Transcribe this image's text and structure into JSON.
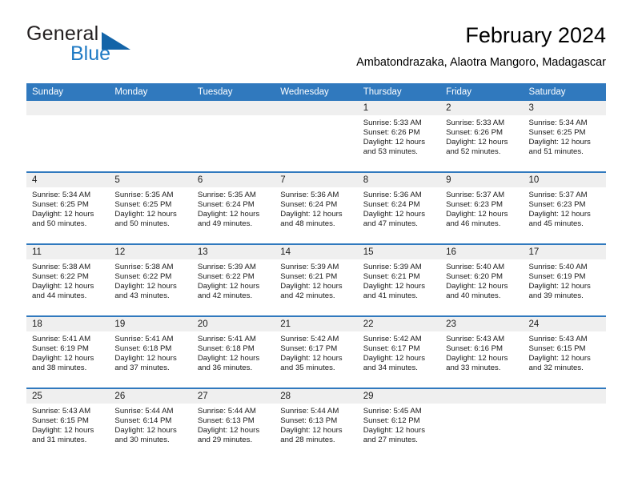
{
  "brand": {
    "name_part1": "General",
    "name_part2": "Blue",
    "logo_icon": "triangle-logo-icon",
    "accent_color": "#1f7ac4"
  },
  "header": {
    "title": "February 2024",
    "subtitle": "Ambatondrazaka, Alaotra Mangoro, Madagascar"
  },
  "theme": {
    "header_blue": "#3079be",
    "date_band_gray": "#efefef",
    "text_color": "#1a1a1a"
  },
  "calendar": {
    "weekdays": [
      "Sunday",
      "Monday",
      "Tuesday",
      "Wednesday",
      "Thursday",
      "Friday",
      "Saturday"
    ],
    "weeks": [
      [
        {
          "day": "",
          "sunrise": "",
          "sunset": "",
          "daylight_line1": "",
          "daylight_line2": ""
        },
        {
          "day": "",
          "sunrise": "",
          "sunset": "",
          "daylight_line1": "",
          "daylight_line2": ""
        },
        {
          "day": "",
          "sunrise": "",
          "sunset": "",
          "daylight_line1": "",
          "daylight_line2": ""
        },
        {
          "day": "",
          "sunrise": "",
          "sunset": "",
          "daylight_line1": "",
          "daylight_line2": ""
        },
        {
          "day": "1",
          "sunrise": "Sunrise: 5:33 AM",
          "sunset": "Sunset: 6:26 PM",
          "daylight_line1": "Daylight: 12 hours",
          "daylight_line2": "and 53 minutes."
        },
        {
          "day": "2",
          "sunrise": "Sunrise: 5:33 AM",
          "sunset": "Sunset: 6:26 PM",
          "daylight_line1": "Daylight: 12 hours",
          "daylight_line2": "and 52 minutes."
        },
        {
          "day": "3",
          "sunrise": "Sunrise: 5:34 AM",
          "sunset": "Sunset: 6:25 PM",
          "daylight_line1": "Daylight: 12 hours",
          "daylight_line2": "and 51 minutes."
        }
      ],
      [
        {
          "day": "4",
          "sunrise": "Sunrise: 5:34 AM",
          "sunset": "Sunset: 6:25 PM",
          "daylight_line1": "Daylight: 12 hours",
          "daylight_line2": "and 50 minutes."
        },
        {
          "day": "5",
          "sunrise": "Sunrise: 5:35 AM",
          "sunset": "Sunset: 6:25 PM",
          "daylight_line1": "Daylight: 12 hours",
          "daylight_line2": "and 50 minutes."
        },
        {
          "day": "6",
          "sunrise": "Sunrise: 5:35 AM",
          "sunset": "Sunset: 6:24 PM",
          "daylight_line1": "Daylight: 12 hours",
          "daylight_line2": "and 49 minutes."
        },
        {
          "day": "7",
          "sunrise": "Sunrise: 5:36 AM",
          "sunset": "Sunset: 6:24 PM",
          "daylight_line1": "Daylight: 12 hours",
          "daylight_line2": "and 48 minutes."
        },
        {
          "day": "8",
          "sunrise": "Sunrise: 5:36 AM",
          "sunset": "Sunset: 6:24 PM",
          "daylight_line1": "Daylight: 12 hours",
          "daylight_line2": "and 47 minutes."
        },
        {
          "day": "9",
          "sunrise": "Sunrise: 5:37 AM",
          "sunset": "Sunset: 6:23 PM",
          "daylight_line1": "Daylight: 12 hours",
          "daylight_line2": "and 46 minutes."
        },
        {
          "day": "10",
          "sunrise": "Sunrise: 5:37 AM",
          "sunset": "Sunset: 6:23 PM",
          "daylight_line1": "Daylight: 12 hours",
          "daylight_line2": "and 45 minutes."
        }
      ],
      [
        {
          "day": "11",
          "sunrise": "Sunrise: 5:38 AM",
          "sunset": "Sunset: 6:22 PM",
          "daylight_line1": "Daylight: 12 hours",
          "daylight_line2": "and 44 minutes."
        },
        {
          "day": "12",
          "sunrise": "Sunrise: 5:38 AM",
          "sunset": "Sunset: 6:22 PM",
          "daylight_line1": "Daylight: 12 hours",
          "daylight_line2": "and 43 minutes."
        },
        {
          "day": "13",
          "sunrise": "Sunrise: 5:39 AM",
          "sunset": "Sunset: 6:22 PM",
          "daylight_line1": "Daylight: 12 hours",
          "daylight_line2": "and 42 minutes."
        },
        {
          "day": "14",
          "sunrise": "Sunrise: 5:39 AM",
          "sunset": "Sunset: 6:21 PM",
          "daylight_line1": "Daylight: 12 hours",
          "daylight_line2": "and 42 minutes."
        },
        {
          "day": "15",
          "sunrise": "Sunrise: 5:39 AM",
          "sunset": "Sunset: 6:21 PM",
          "daylight_line1": "Daylight: 12 hours",
          "daylight_line2": "and 41 minutes."
        },
        {
          "day": "16",
          "sunrise": "Sunrise: 5:40 AM",
          "sunset": "Sunset: 6:20 PM",
          "daylight_line1": "Daylight: 12 hours",
          "daylight_line2": "and 40 minutes."
        },
        {
          "day": "17",
          "sunrise": "Sunrise: 5:40 AM",
          "sunset": "Sunset: 6:19 PM",
          "daylight_line1": "Daylight: 12 hours",
          "daylight_line2": "and 39 minutes."
        }
      ],
      [
        {
          "day": "18",
          "sunrise": "Sunrise: 5:41 AM",
          "sunset": "Sunset: 6:19 PM",
          "daylight_line1": "Daylight: 12 hours",
          "daylight_line2": "and 38 minutes."
        },
        {
          "day": "19",
          "sunrise": "Sunrise: 5:41 AM",
          "sunset": "Sunset: 6:18 PM",
          "daylight_line1": "Daylight: 12 hours",
          "daylight_line2": "and 37 minutes."
        },
        {
          "day": "20",
          "sunrise": "Sunrise: 5:41 AM",
          "sunset": "Sunset: 6:18 PM",
          "daylight_line1": "Daylight: 12 hours",
          "daylight_line2": "and 36 minutes."
        },
        {
          "day": "21",
          "sunrise": "Sunrise: 5:42 AM",
          "sunset": "Sunset: 6:17 PM",
          "daylight_line1": "Daylight: 12 hours",
          "daylight_line2": "and 35 minutes."
        },
        {
          "day": "22",
          "sunrise": "Sunrise: 5:42 AM",
          "sunset": "Sunset: 6:17 PM",
          "daylight_line1": "Daylight: 12 hours",
          "daylight_line2": "and 34 minutes."
        },
        {
          "day": "23",
          "sunrise": "Sunrise: 5:43 AM",
          "sunset": "Sunset: 6:16 PM",
          "daylight_line1": "Daylight: 12 hours",
          "daylight_line2": "and 33 minutes."
        },
        {
          "day": "24",
          "sunrise": "Sunrise: 5:43 AM",
          "sunset": "Sunset: 6:15 PM",
          "daylight_line1": "Daylight: 12 hours",
          "daylight_line2": "and 32 minutes."
        }
      ],
      [
        {
          "day": "25",
          "sunrise": "Sunrise: 5:43 AM",
          "sunset": "Sunset: 6:15 PM",
          "daylight_line1": "Daylight: 12 hours",
          "daylight_line2": "and 31 minutes."
        },
        {
          "day": "26",
          "sunrise": "Sunrise: 5:44 AM",
          "sunset": "Sunset: 6:14 PM",
          "daylight_line1": "Daylight: 12 hours",
          "daylight_line2": "and 30 minutes."
        },
        {
          "day": "27",
          "sunrise": "Sunrise: 5:44 AM",
          "sunset": "Sunset: 6:13 PM",
          "daylight_line1": "Daylight: 12 hours",
          "daylight_line2": "and 29 minutes."
        },
        {
          "day": "28",
          "sunrise": "Sunrise: 5:44 AM",
          "sunset": "Sunset: 6:13 PM",
          "daylight_line1": "Daylight: 12 hours",
          "daylight_line2": "and 28 minutes."
        },
        {
          "day": "29",
          "sunrise": "Sunrise: 5:45 AM",
          "sunset": "Sunset: 6:12 PM",
          "daylight_line1": "Daylight: 12 hours",
          "daylight_line2": "and 27 minutes."
        },
        {
          "day": "",
          "sunrise": "",
          "sunset": "",
          "daylight_line1": "",
          "daylight_line2": ""
        },
        {
          "day": "",
          "sunrise": "",
          "sunset": "",
          "daylight_line1": "",
          "daylight_line2": ""
        }
      ]
    ]
  }
}
